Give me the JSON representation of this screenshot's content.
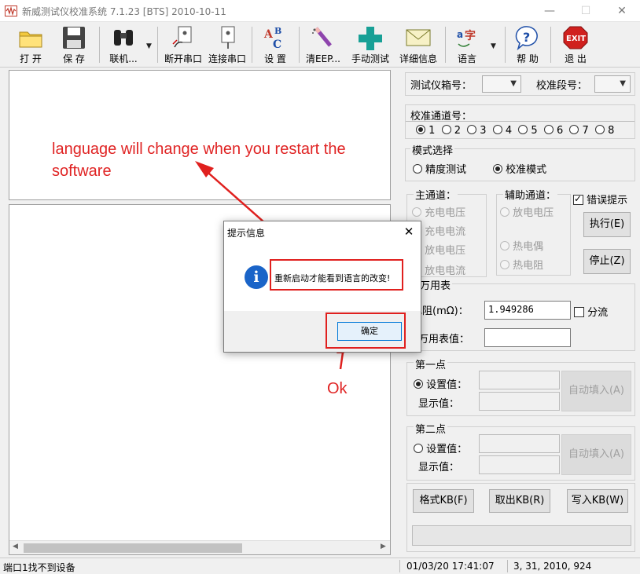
{
  "window": {
    "title": "新威测试仪校准系统 7.1.23     [BTS]  2010-10-11",
    "minimize": "—",
    "maximize": "☐",
    "close": "✕"
  },
  "toolbar": {
    "open": "打 开",
    "save": "保 存",
    "connect": "联机...",
    "disconnect_port": "断开串口",
    "connect_port": "连接串口",
    "settings": "设 置",
    "clear_eep": "清EEP...",
    "manual_test": "手动测试",
    "details": "详细信息",
    "language": "语言",
    "help": "帮 助",
    "exit": "退 出",
    "exit_icon_text": "EXIT",
    "dropdown_arrow": "▼"
  },
  "right": {
    "box_no_label": "测试仪箱号：",
    "segment_label": "校准段号：",
    "channel_label": "校准通道号：",
    "channels": [
      "1",
      "2",
      "3",
      "4",
      "5",
      "6",
      "7",
      "8"
    ],
    "mode_title": "模式选择",
    "mode_precision": "精度测试",
    "mode_calibrate": "校准模式",
    "main_channel": "主通道：",
    "aux_channel": "辅助通道：",
    "error_hint": "错误提示",
    "charge_voltage": "充电电压",
    "charge_current": "充电电流",
    "discharge_voltage": "放电电压",
    "discharge_current": "放电电流",
    "aux_discharge_voltage": "放电电压",
    "thermocouple": "热电偶",
    "thermistor": "热电阻",
    "execute": "执行(E)",
    "stop": "停止(Z)",
    "multimeter": "万用表",
    "resistance_label": "电阻(mΩ)：",
    "resistance_value": "1.949286",
    "shunt": "分流",
    "multimeter_value_label": "万用表值：",
    "multimeter_value": "",
    "point1": "第一点",
    "point2": "第二点",
    "set_value": "设置值：",
    "display_value": "显示值：",
    "auto_fill": "自动填入(A)",
    "format_kb": "格式KB(F)",
    "fetch_kb": "取出KB(R)",
    "write_kb": "写入KB(W)"
  },
  "status": {
    "port": "端口1找不到设备",
    "datetime": "01/03/20 17:41:07",
    "info": "3, 31, 2010, 924"
  },
  "dialog": {
    "title": "提示信息",
    "close": "✕",
    "icon": "i",
    "message": "重新启动才能看到语言的改变!",
    "ok": "确定"
  },
  "annotations": {
    "line1": "language will change when you restart the",
    "line2": "software",
    "ok": "Ok"
  },
  "colors": {
    "annotation_red": "#e0201e",
    "info_blue": "#1a64c8"
  }
}
